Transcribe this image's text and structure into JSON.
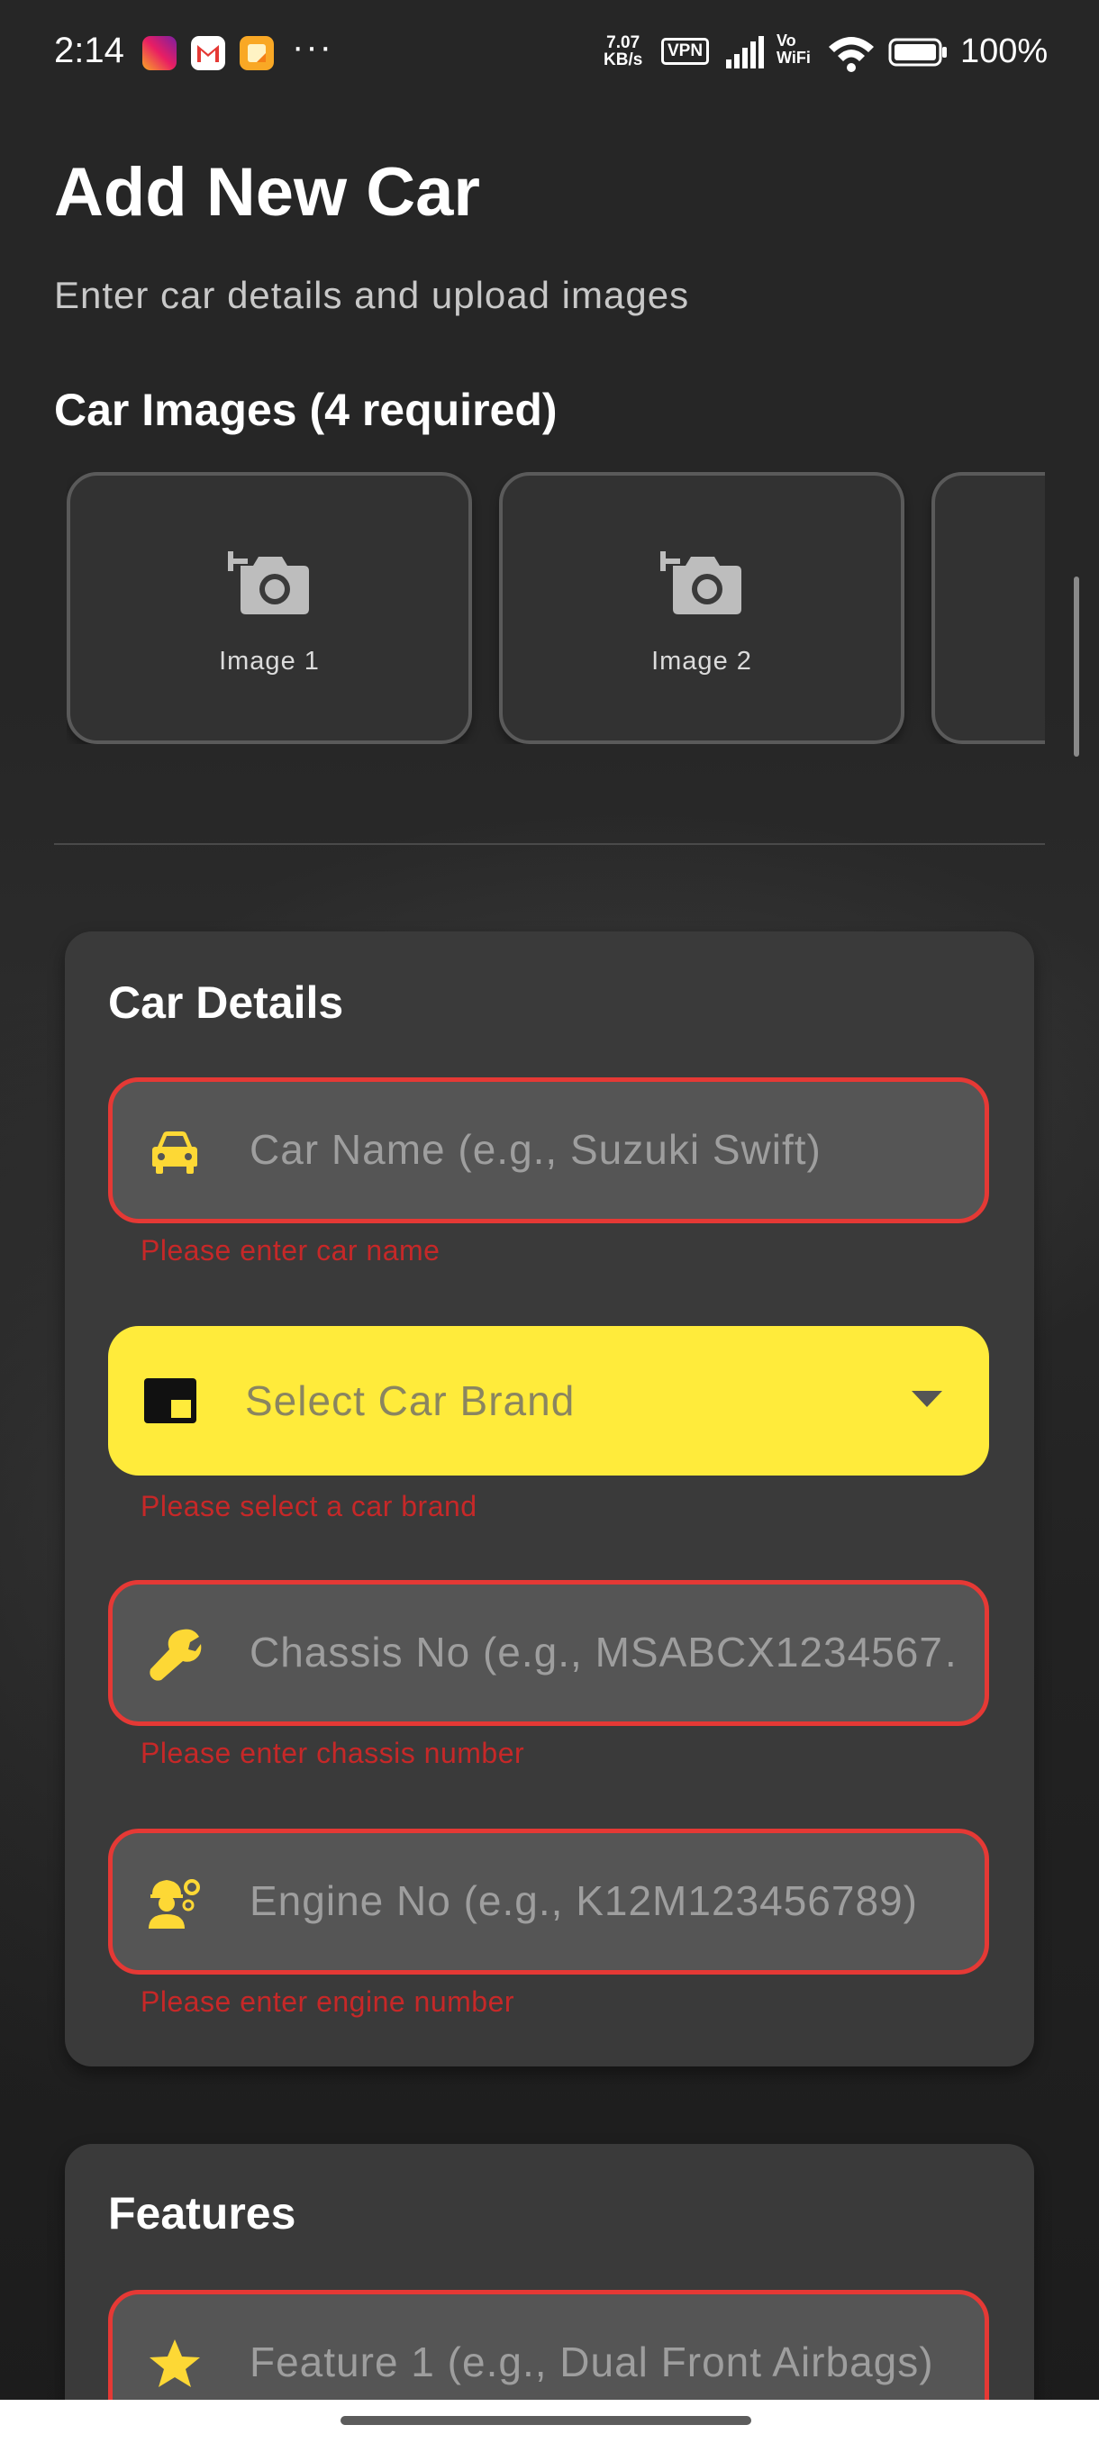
{
  "status_bar": {
    "time": "2:14",
    "apps": [
      "instagram-icon",
      "gmail-icon",
      "notes-icon"
    ],
    "more": "···",
    "net_speed_value": "7.07",
    "net_speed_unit": "KB/s",
    "vpn": "VPN",
    "vowifi_top": "Vo",
    "vowifi_bottom": "WiFi",
    "battery": "100%"
  },
  "header": {
    "title": "Add New Car",
    "subtitle": "Enter car details and upload images"
  },
  "images": {
    "heading": "Car Images (4 required)",
    "tiles": [
      {
        "label": "Image 1",
        "icon": "add-photo-icon"
      },
      {
        "label": "Image 2",
        "icon": "add-photo-icon"
      },
      {
        "label": "",
        "icon": "add-photo-icon"
      }
    ]
  },
  "car_details": {
    "title": "Car Details",
    "fields": {
      "car_name": {
        "placeholder": "Car Name (e.g., Suzuki Swift)",
        "error": "Please enter car name",
        "icon": "car-icon"
      },
      "brand": {
        "placeholder": "Select Car Brand",
        "error": "Please select a car brand",
        "icon": "picture-in-picture-icon"
      },
      "chassis": {
        "placeholder": "Chassis No (e.g., MSABCX1234567…",
        "error": "Please enter chassis number",
        "icon": "wrench-icon"
      },
      "engine": {
        "placeholder": "Engine No (e.g., K12M123456789)",
        "error": "Please enter engine number",
        "icon": "engineer-icon"
      }
    }
  },
  "features": {
    "title": "Features",
    "fields": {
      "feature1": {
        "placeholder": "Feature 1 (e.g., Dual Front Airbags)",
        "icon": "star-icon"
      }
    }
  },
  "colors": {
    "accent": "#ffeb3b",
    "error": "#e53935",
    "card": "#3a3a3a",
    "field": "#555555"
  }
}
